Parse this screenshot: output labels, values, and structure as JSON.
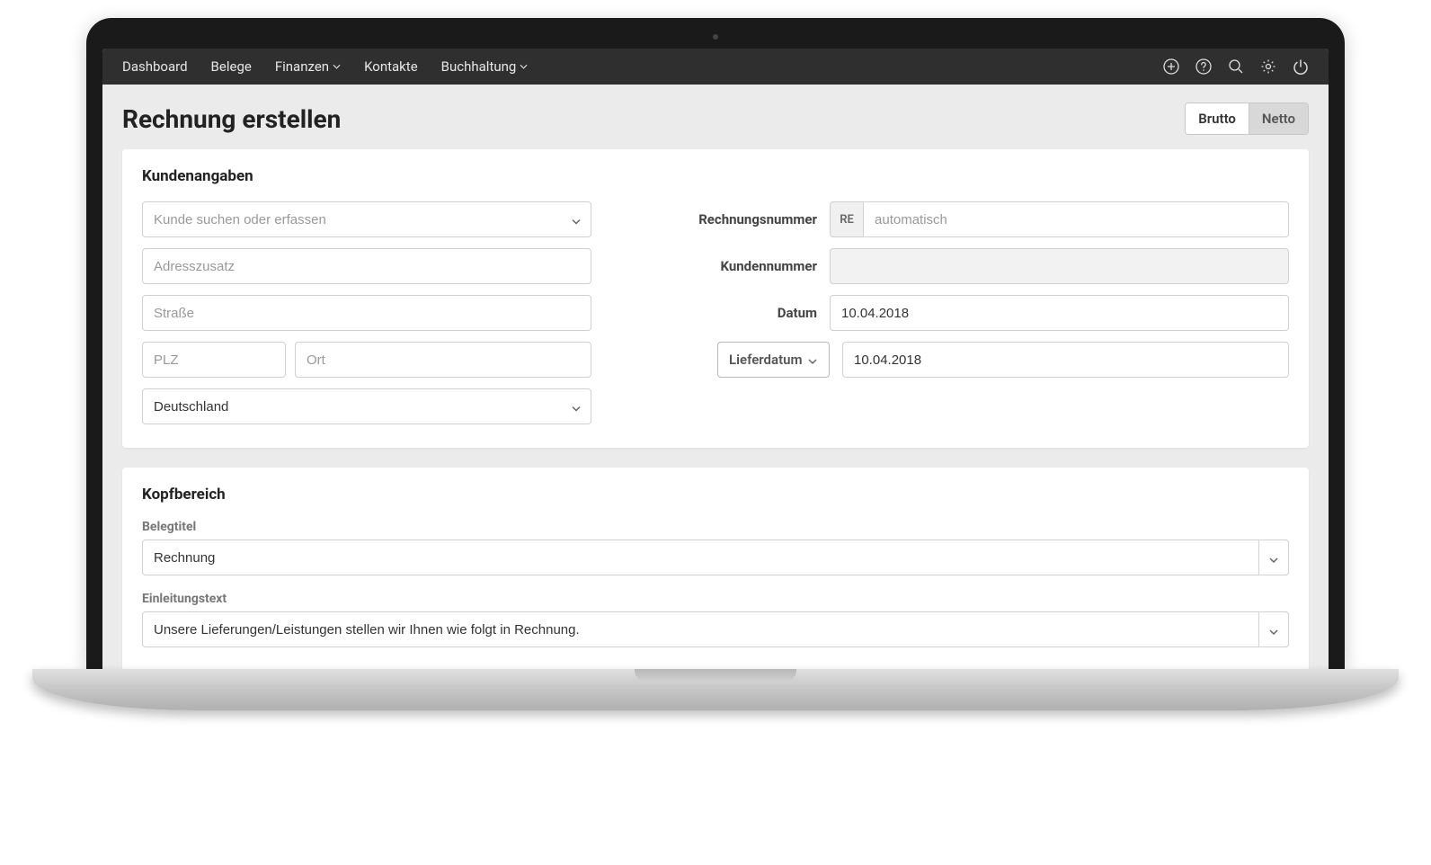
{
  "nav": {
    "items": [
      {
        "label": "Dashboard",
        "dropdown": false
      },
      {
        "label": "Belege",
        "dropdown": false
      },
      {
        "label": "Finanzen",
        "dropdown": true
      },
      {
        "label": "Kontakte",
        "dropdown": false
      },
      {
        "label": "Buchhaltung",
        "dropdown": true
      }
    ]
  },
  "header": {
    "title": "Rechnung erstellen",
    "toggle": {
      "brutto": "Brutto",
      "netto": "Netto",
      "active": "netto"
    }
  },
  "customer_section": {
    "title": "Kundenangaben",
    "search_placeholder": "Kunde suchen oder erfassen",
    "addition_placeholder": "Adresszusatz",
    "street_placeholder": "Straße",
    "zip_placeholder": "PLZ",
    "city_placeholder": "Ort",
    "country_value": "Deutschland",
    "labels": {
      "invoice_number": "Rechnungsnummer",
      "customer_number": "Kundennummer",
      "date": "Datum",
      "delivery_date": "Lieferdatum"
    },
    "invoice_prefix": "RE",
    "invoice_number_placeholder": "automatisch",
    "customer_number_value": "",
    "date_value": "10.04.2018",
    "delivery_date_value": "10.04.2018"
  },
  "head_section": {
    "title": "Kopfbereich",
    "doc_title_label": "Belegtitel",
    "doc_title_value": "Rechnung",
    "intro_label": "Einleitungstext",
    "intro_value": "Unsere Lieferungen/Leistungen stellen wir Ihnen wie folgt in Rechnung."
  }
}
